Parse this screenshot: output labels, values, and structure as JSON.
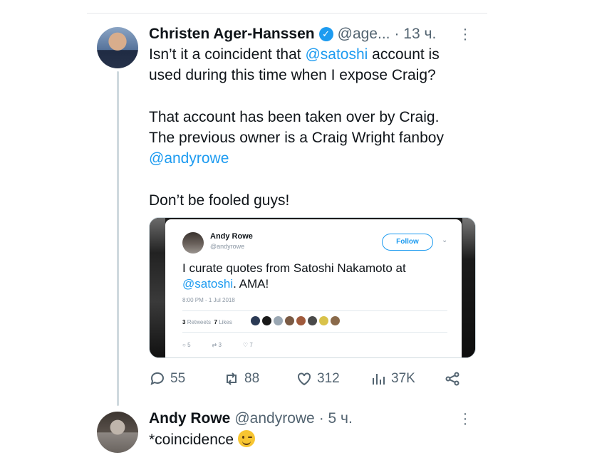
{
  "tweet1": {
    "name": "Christen Ager-Hanssen",
    "handle": "@age...",
    "time": "· 13 ч.",
    "lines": [
      {
        "pre": "Isn’t it a coincident that ",
        "link": "@satoshi",
        "post": " account is"
      },
      {
        "text": "used during this time when I expose Craig?"
      },
      {
        "text": "That account has been taken over by Craig."
      },
      {
        "text": "The previous owner is a Craig Wright fanboy"
      },
      {
        "link": "@andyrowe"
      },
      {
        "text": "Don’t be fooled guys!"
      }
    ],
    "actions": {
      "replies": "55",
      "reposts": "88",
      "likes": "312",
      "views": "37K"
    }
  },
  "quoted_screenshot": {
    "name": "Andy Rowe",
    "handle": "@andyrowe",
    "follow_label": "Follow",
    "text_line1": "I curate quotes from Satoshi Nakamoto at",
    "text_link": "@satoshi",
    "text_after": ".  AMA!",
    "date": "8:00 PM - 1 Jul 2018",
    "retweets_count": "3",
    "retweets_label": "Retweets",
    "likes_count": "7",
    "likes_label": "Likes",
    "reply_count": "5",
    "retweet_action_count": "3",
    "like_action_count": "7"
  },
  "tweet2": {
    "name": "Andy Rowe",
    "handle": "@andyrowe",
    "time": "· 5 ч.",
    "text": "*coincidence"
  },
  "colors": {
    "link": "#1d9bf0",
    "verified": "#1d9bf0",
    "muted": "#536471"
  }
}
